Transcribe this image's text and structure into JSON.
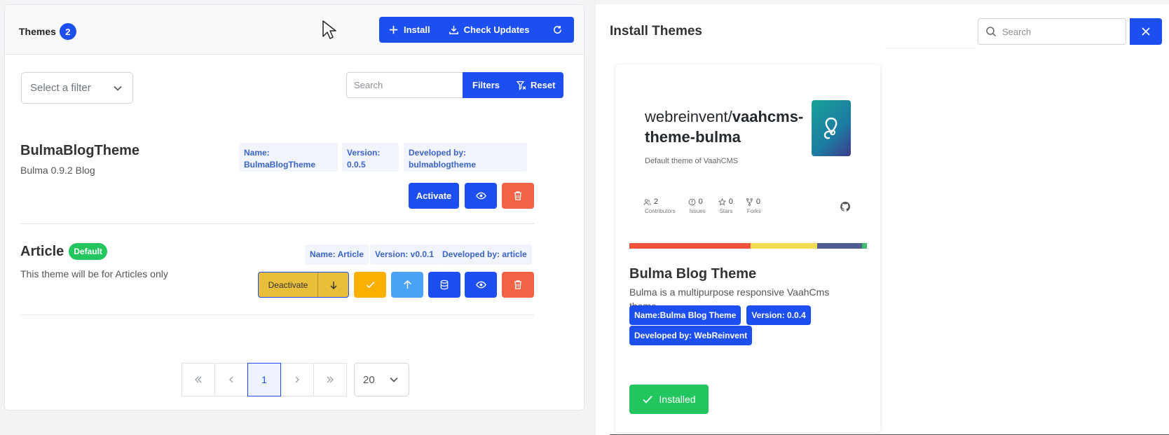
{
  "left": {
    "title": "Themes",
    "count": "2",
    "toolbar": {
      "install": "Install",
      "check_updates": "Check Updates"
    },
    "filter": {
      "placeholder": "Select a filter"
    },
    "search": {
      "placeholder": "Search",
      "filters": "Filters",
      "reset": "Reset"
    },
    "themes": [
      {
        "name": "BulmaBlogTheme",
        "description": "Bulma 0.9.2 Blog",
        "meta": {
          "name": "Name:\nBulmaBlogTheme",
          "version": "Version:\n0.0.5",
          "developer": "Developed by:\nbulmablogtheme"
        },
        "primary_action": "Activate"
      },
      {
        "name": "Article",
        "badge": "Default",
        "description": "This theme will be for Articles only",
        "meta": {
          "name": "Name: Article",
          "version": "Version: v0.0.1",
          "developer": "Developed by: article"
        },
        "primary_action": "Deactivate"
      }
    ],
    "pagination": {
      "current": "1",
      "per_page": "20"
    }
  },
  "right": {
    "title": "Install Themes",
    "search_placeholder": "Search",
    "card": {
      "repo_owner": "webreinvent/",
      "repo_name_1": "vaahcms-",
      "repo_name_2": "theme-bulma",
      "repo_desc": "Default theme of VaahCMS",
      "stats": [
        {
          "value": "2",
          "label": "Contributors",
          "icon": "people-icon"
        },
        {
          "value": "0",
          "label": "Issues",
          "icon": "issue-icon"
        },
        {
          "value": "0",
          "label": "Stars",
          "icon": "star-icon"
        },
        {
          "value": "0",
          "label": "Forks",
          "icon": "fork-icon"
        }
      ],
      "languages": [
        {
          "color": "#f1533e",
          "share": 0.51
        },
        {
          "color": "#efdc50",
          "share": 0.28
        },
        {
          "color": "#515c8e",
          "share": 0.19
        },
        {
          "color": "#3ebd6a",
          "share": 0.02
        }
      ],
      "title": "Bulma Blog Theme",
      "description": "Bulma is a multipurpose responsive VaahCms theme.",
      "tags": {
        "name": "Name:Bulma Blog Theme",
        "version": "Version: 0.0.4",
        "developer": "Developed by: WebReinvent"
      },
      "installed_label": "Installed"
    }
  },
  "colors": {
    "primary": "#1d4ff0",
    "danger": "#f46245",
    "success": "#22c55e",
    "warning": "#fab000",
    "info": "#4aa3f7",
    "deactivate": "#e9be3b"
  }
}
